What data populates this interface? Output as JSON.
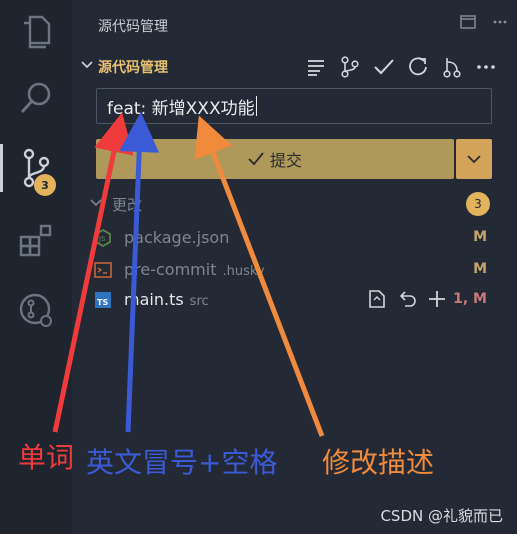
{
  "panel": {
    "title": "源代码管理",
    "section_title": "源代码管理"
  },
  "activity": {
    "scm_badge": "3"
  },
  "commit": {
    "message": "feat: 新增XXX功能",
    "button_label": "提交"
  },
  "changes": {
    "label": "更改",
    "count": "3",
    "files": [
      {
        "name": "package.json",
        "dir": "",
        "status": "M"
      },
      {
        "name": "pre-commit",
        "dir": ".husky",
        "status": "M"
      },
      {
        "name": "main.ts",
        "dir": "src",
        "status": "1, M"
      }
    ]
  },
  "annotations": {
    "word": "单词",
    "colon_space": "英文冒号+空格",
    "description": "修改描述"
  },
  "colors": {
    "word": "#ef3b3b",
    "colon_space": "#3b5bd6",
    "description": "#f08a3c"
  },
  "watermark": "CSDN @礼貌而已"
}
